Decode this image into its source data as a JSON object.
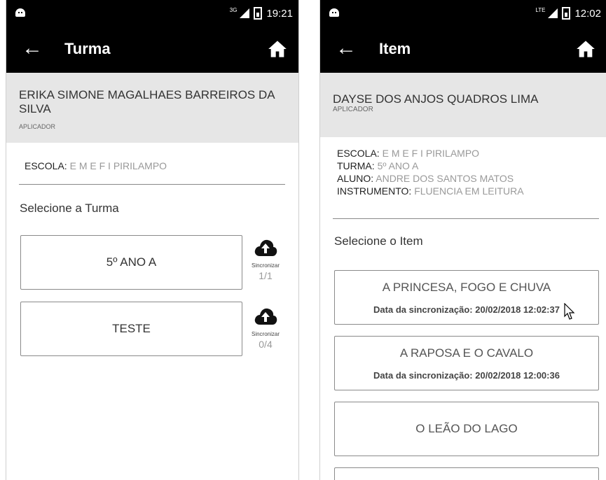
{
  "left": {
    "status_net": "3G",
    "status_time": "19:21",
    "title": "Turma",
    "username": "ERIKA SIMONE MAGALHAES BARREIROS DA SILVA",
    "role": "APLICADOR",
    "escola_label": "ESCOLA:",
    "escola_value": "E M E F I PIRILAMPO",
    "section": "Selecione a Turma",
    "cards": [
      {
        "label": "5º ANO A",
        "sync_label": "Sincronizar",
        "count": "1/1"
      },
      {
        "label": "TESTE",
        "sync_label": "Sincronizar",
        "count": "0/4"
      }
    ]
  },
  "right": {
    "status_net": "LTE",
    "status_time": "12:02",
    "title": "Item",
    "username": "DAYSE DOS ANJOS QUADROS LIMA",
    "role": "APLICADOR",
    "escola_label": "ESCOLA:",
    "escola_value": "E M E F I PIRILAMPO",
    "turma_label": "TURMA:",
    "turma_value": "5º ANO A",
    "aluno_label": "ALUNO:",
    "aluno_value": "ANDRE DOS SANTOS MATOS",
    "instrumento_label": "INSTRUMENTO:",
    "instrumento_value": "FLUENCIA EM LEITURA",
    "section": "Selecione o Item",
    "items": [
      {
        "label": "A PRINCESA, FOGO E CHUVA",
        "date": "Data da sincronização: 20/02/2018 12:02:37"
      },
      {
        "label": "A RAPOSA E O CAVALO",
        "date": "Data da sincronização: 20/02/2018 12:00:36"
      },
      {
        "label": "O LEÃO DO LAGO"
      }
    ]
  },
  "icons": {
    "back": "arrow-left-icon",
    "home": "home-icon",
    "sync": "cloud-upload-icon"
  }
}
